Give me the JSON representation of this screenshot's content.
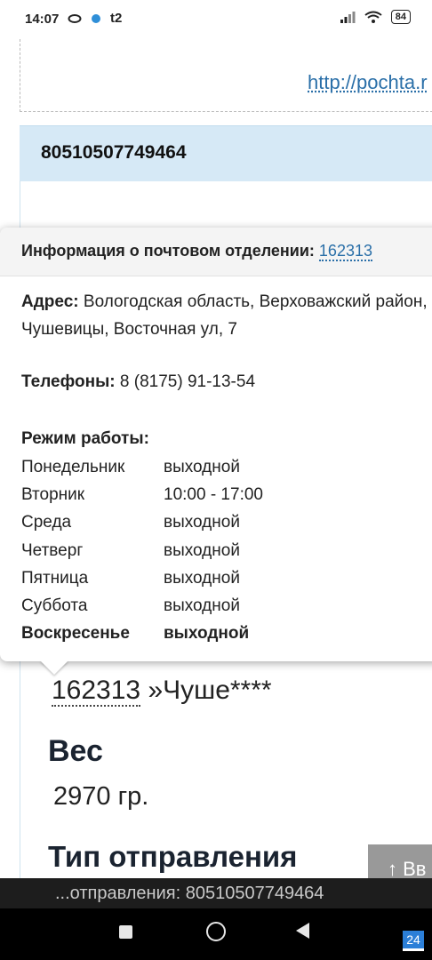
{
  "status_bar": {
    "time": "14:07",
    "carrier": "t2",
    "battery": "84"
  },
  "page": {
    "url_text": "http://pochta.r",
    "tracking_number": "80510507749464",
    "office_line_code": "162313",
    "office_line_name": "»Чуше****",
    "weight_title": "Вес",
    "weight_value": "2970 гр.",
    "type_title": "Тип отправления",
    "up_button_label": "Вв"
  },
  "popup": {
    "title": "Информация о почтовом отделении:",
    "office_code": "162313",
    "address_label": "Адрес:",
    "address_value": "Вологодская область, Верховажский район, Чушевицы, Восточная ул, 7",
    "phones_label": "Телефоны:",
    "phones_value": "8 (8175) 91-13-54",
    "hours_label": "Режим работы:",
    "hours": [
      {
        "day": "Понедельник",
        "time": "выходной"
      },
      {
        "day": "Вторник",
        "time": "10:00 - 17:00"
      },
      {
        "day": "Среда",
        "time": "выходной"
      },
      {
        "day": "Четверг",
        "time": "выходной"
      },
      {
        "day": "Пятница",
        "time": "выходной"
      },
      {
        "day": "Суббота",
        "time": "выходной"
      },
      {
        "day": "Воскресенье",
        "time": "выходной"
      }
    ]
  },
  "snackbar": {
    "text": "...отправления: 80510507749464"
  },
  "badge": {
    "text": "24"
  }
}
